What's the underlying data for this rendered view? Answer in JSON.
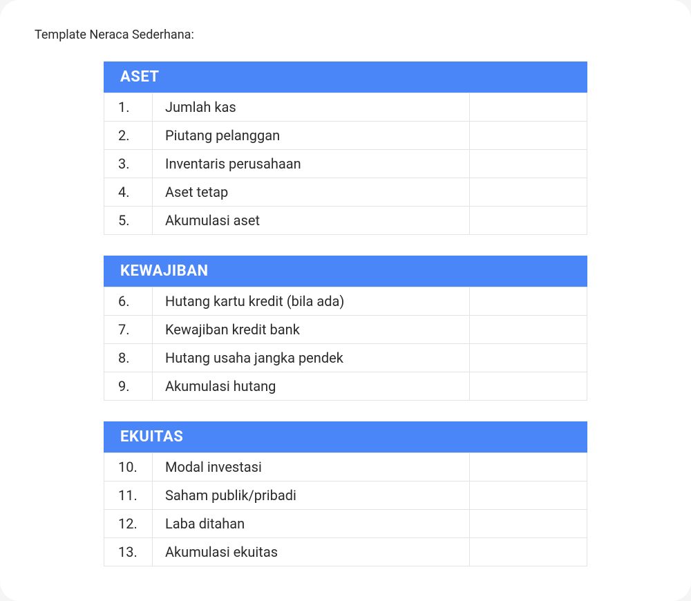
{
  "title": "Template Neraca Sederhana:",
  "sections": [
    {
      "header": "ASET",
      "rows": [
        {
          "num": "1.",
          "label": "Jumlah kas",
          "value": ""
        },
        {
          "num": "2.",
          "label": "Piutang pelanggan",
          "value": ""
        },
        {
          "num": "3.",
          "label": "Inventaris perusahaan",
          "value": ""
        },
        {
          "num": "4.",
          "label": "Aset tetap",
          "value": ""
        },
        {
          "num": "5.",
          "label": "Akumulasi aset",
          "value": ""
        }
      ]
    },
    {
      "header": "KEWAJIBAN",
      "rows": [
        {
          "num": "6.",
          "label": "Hutang kartu kredit (bila ada)",
          "value": ""
        },
        {
          "num": "7.",
          "label": "Kewajiban kredit bank",
          "value": ""
        },
        {
          "num": "8.",
          "label": "Hutang usaha jangka pendek",
          "value": ""
        },
        {
          "num": "9.",
          "label": "Akumulasi hutang",
          "value": ""
        }
      ]
    },
    {
      "header": "EKUITAS",
      "rows": [
        {
          "num": "10.",
          "label": "Modal investasi",
          "value": ""
        },
        {
          "num": "11.",
          "label": "Saham publik/pribadi",
          "value": ""
        },
        {
          "num": "12.",
          "label": "Laba ditahan",
          "value": ""
        },
        {
          "num": "13.",
          "label": "Akumulasi ekuitas",
          "value": ""
        }
      ]
    }
  ]
}
